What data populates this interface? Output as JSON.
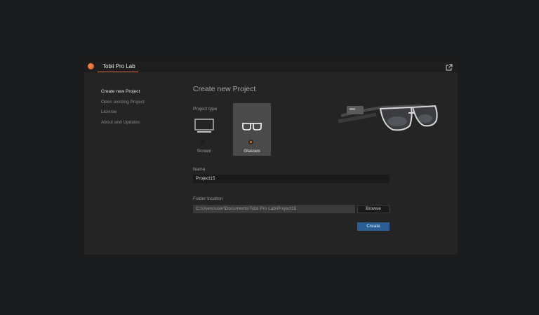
{
  "app": {
    "tab_title": "Tobii Pro Lab"
  },
  "sidebar": {
    "items": [
      {
        "label": "Create new Project",
        "active": true
      },
      {
        "label": "Open existing Project",
        "active": false
      },
      {
        "label": "License",
        "active": false
      },
      {
        "label": "About and Updates",
        "active": false
      }
    ]
  },
  "main": {
    "title": "Create new Project",
    "project_type": {
      "label": "Project type",
      "options": [
        {
          "label": "Screen",
          "icon": "monitor-icon",
          "selected": false
        },
        {
          "label": "Glasses",
          "icon": "glasses-icon",
          "selected": true
        }
      ]
    },
    "name": {
      "label": "Name",
      "value": "Project15"
    },
    "folder": {
      "label": "Folder location",
      "value": "C:\\Users\\user\\Documents\\Tobii Pro Lab\\Project15",
      "browse_label": "Browse"
    },
    "create_label": "Create"
  },
  "colors": {
    "accent_orange": "#e0693a",
    "create_blue": "#2a5e94",
    "window_bg": "#242424",
    "page_bg": "#1a1b1d"
  },
  "icons": [
    "app-logo-icon",
    "popout-icon",
    "monitor-icon",
    "glasses-icon"
  ]
}
